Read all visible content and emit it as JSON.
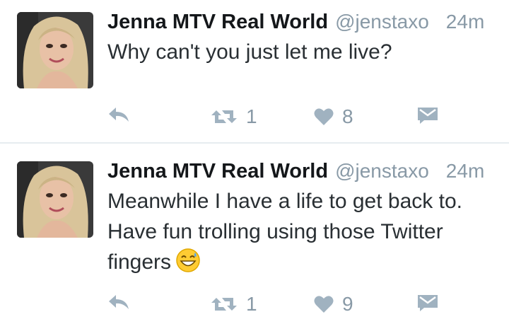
{
  "tweets": [
    {
      "name": "Jenna MTV Real World",
      "handle": "@jenstaxo",
      "time": "24m",
      "text_lines": [
        "Why can't you just let me live?"
      ],
      "retweets": "1",
      "likes": "8"
    },
    {
      "name": "Jenna MTV Real World",
      "handle": "@jenstaxo",
      "time": "24m",
      "text_lines": [
        "Meanwhile I have a life to get back to.",
        "Have fun trolling using those Twitter",
        "fingers"
      ],
      "emoji": "grinning-face-with-sweat-emoji",
      "retweets": "1",
      "likes": "9"
    }
  ],
  "icons": {
    "reply": "reply-icon",
    "retweet": "retweet-icon",
    "like": "heart-icon",
    "dm": "direct-message-icon"
  },
  "colors": {
    "icon": "#a0b2c0",
    "text_muted": "#8899a6"
  }
}
